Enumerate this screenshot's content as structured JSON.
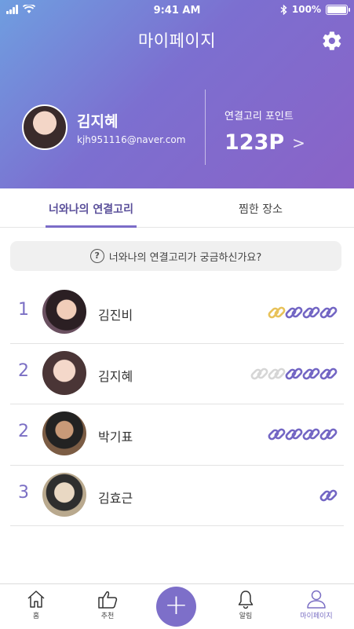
{
  "status_bar": {
    "time": "9:41 AM",
    "battery": "100%"
  },
  "header": {
    "title": "마이페이지",
    "settings_icon": "gear-icon"
  },
  "profile": {
    "name": "김지혜",
    "email": "kjh951116@naver.com"
  },
  "points": {
    "label": "연결고리 포인트",
    "value": "123P",
    "chevron": ">"
  },
  "tabs": [
    {
      "label": "너와나의 연결고리",
      "active": true
    },
    {
      "label": "찜한 장소",
      "active": false
    }
  ],
  "info_bar": {
    "icon": "?",
    "text": "너와나의 연결고리가 궁금하신가요?"
  },
  "ranking": [
    {
      "rank": "1",
      "name": "김진비",
      "chains": [
        "gold",
        "purple",
        "purple",
        "purple"
      ]
    },
    {
      "rank": "2",
      "name": "김지혜",
      "chains": [
        "gray",
        "gray",
        "purple",
        "purple",
        "purple"
      ]
    },
    {
      "rank": "2",
      "name": "박기표",
      "chains": [
        "purple",
        "purple",
        "purple",
        "purple"
      ]
    },
    {
      "rank": "3",
      "name": "김효근",
      "chains": [
        "purple"
      ]
    }
  ],
  "colors": {
    "accent": "#7b6fc4",
    "gold": "#e8c25a",
    "purple": "#7366c4",
    "gray": "#d6d6d6"
  },
  "bottom_nav": {
    "home": "홈",
    "recommend": "추천",
    "add": "+",
    "alarm": "알림",
    "mypage": "마이페이지"
  }
}
